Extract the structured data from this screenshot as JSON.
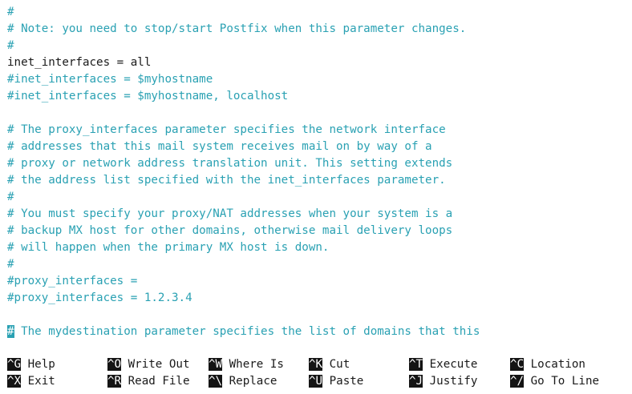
{
  "editor": {
    "lines": [
      {
        "type": "comment",
        "text": "#"
      },
      {
        "type": "comment",
        "text": "# Note: you need to stop/start Postfix when this parameter changes."
      },
      {
        "type": "comment",
        "text": "#"
      },
      {
        "type": "code",
        "text": "inet_interfaces = all"
      },
      {
        "type": "comment",
        "text": "#inet_interfaces = $myhostname"
      },
      {
        "type": "comment",
        "text": "#inet_interfaces = $myhostname, localhost"
      },
      {
        "type": "blank",
        "text": ""
      },
      {
        "type": "comment",
        "text": "# The proxy_interfaces parameter specifies the network interface"
      },
      {
        "type": "comment",
        "text": "# addresses that this mail system receives mail on by way of a"
      },
      {
        "type": "comment",
        "text": "# proxy or network address translation unit. This setting extends"
      },
      {
        "type": "comment",
        "text": "# the address list specified with the inet_interfaces parameter."
      },
      {
        "type": "comment",
        "text": "#"
      },
      {
        "type": "comment",
        "text": "# You must specify your proxy/NAT addresses when your system is a"
      },
      {
        "type": "comment",
        "text": "# backup MX host for other domains, otherwise mail delivery loops"
      },
      {
        "type": "comment",
        "text": "# will happen when the primary MX host is down."
      },
      {
        "type": "comment",
        "text": "#"
      },
      {
        "type": "comment",
        "text": "#proxy_interfaces ="
      },
      {
        "type": "comment",
        "text": "#proxy_interfaces = 1.2.3.4"
      },
      {
        "type": "blank",
        "text": ""
      }
    ],
    "cursor_line": {
      "cursor_char": "#",
      "rest": " The mydestination parameter specifies the list of domains that this"
    }
  },
  "shortcuts": {
    "row1": [
      {
        "key": "^G",
        "label": "Help"
      },
      {
        "key": "^O",
        "label": "Write Out"
      },
      {
        "key": "^W",
        "label": "Where Is"
      },
      {
        "key": "^K",
        "label": "Cut"
      },
      {
        "key": "^T",
        "label": "Execute"
      },
      {
        "key": "^C",
        "label": "Location"
      }
    ],
    "row2": [
      {
        "key": "^X",
        "label": "Exit"
      },
      {
        "key": "^R",
        "label": "Read File"
      },
      {
        "key": "^\\",
        "label": "Replace"
      },
      {
        "key": "^U",
        "label": "Paste"
      },
      {
        "key": "^J",
        "label": "Justify"
      },
      {
        "key": "^/",
        "label": "Go To Line"
      }
    ]
  },
  "colors": {
    "comment": "#2aa1b3",
    "text": "#1a1a1a",
    "key_bg": "#141414",
    "background": "#ffffff"
  }
}
